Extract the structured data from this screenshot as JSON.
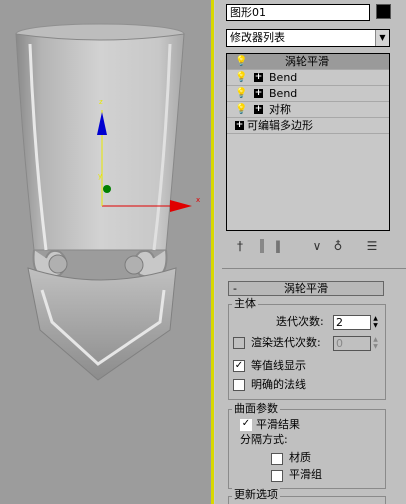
{
  "object_name": "图形01",
  "object_color": "#000000",
  "modifier_list": {
    "label": "修改器列表"
  },
  "stack": [
    {
      "label": "涡轮平滑",
      "selected": true,
      "has_plus": false
    },
    {
      "label": "Bend",
      "selected": false,
      "has_plus": true
    },
    {
      "label": "Bend",
      "selected": false,
      "has_plus": true
    },
    {
      "label": "对称",
      "selected": false,
      "has_plus": true
    },
    {
      "label": "可编辑多边形",
      "selected": false,
      "has_plus": true
    }
  ],
  "toolbar": {
    "pin_stack": "pin-icon",
    "show_end_result": "show-result-icon",
    "make_unique": "make-unique-icon",
    "remove_modifier": "remove-modifier-icon",
    "configure_sets": "configure-sets-icon"
  },
  "rollup": {
    "title": "涡轮平滑",
    "collapse_symbol": "-",
    "main_group": {
      "title": "主体",
      "iterations_label": "迭代次数:",
      "iterations_value": "2",
      "render_iters_label": "渲染迭代次数:",
      "render_iters_value": "0",
      "render_iters_checked": false,
      "isoline_label": "等值线显示",
      "isoline_checked": true,
      "explicit_normals_label": "明确的法线",
      "explicit_normals_checked": false
    },
    "surface_group": {
      "title": "曲面参数",
      "smooth_result_label": "平滑结果",
      "smooth_result_checked": true,
      "separate_label": "分隔方式:",
      "materials_label": "材质",
      "materials_checked": false,
      "smoothing_groups_label": "平滑组",
      "smoothing_groups_checked": false
    },
    "update_group": {
      "title": "更新选项"
    }
  },
  "gizmo": {
    "axis_x_color": "#e00000",
    "axis_y_color": "#e8e800",
    "axis_z_color": "#0000d0"
  }
}
